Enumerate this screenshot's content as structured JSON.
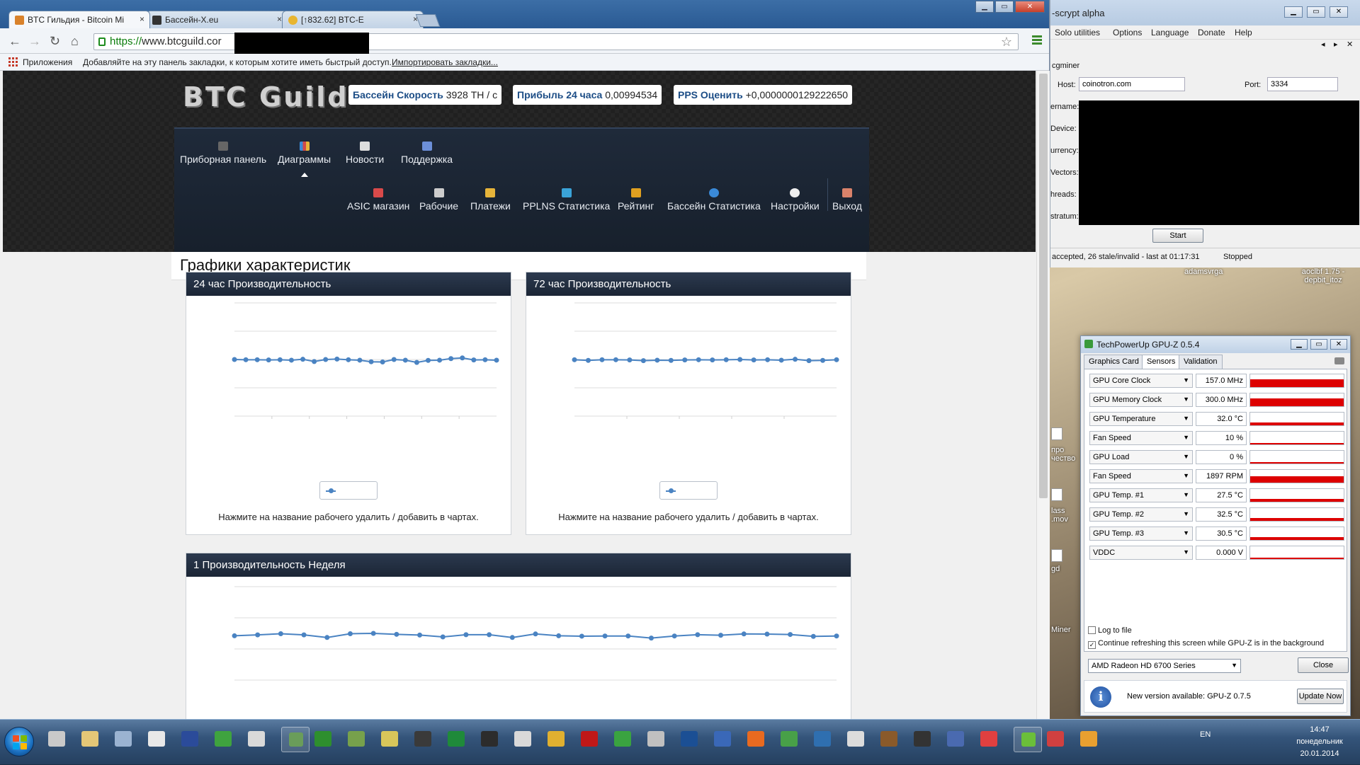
{
  "browser": {
    "tabs": [
      {
        "title": "BTC Гильдия - Bitcoin Mi",
        "favicon_color": "#d9822b",
        "active": true
      },
      {
        "title": "Бассейн-X.eu",
        "favicon_color": "#333333",
        "active": false
      },
      {
        "title": "[↑832.62] BTC-E",
        "favicon_color": "#e8b530",
        "active": false
      }
    ],
    "tab_close": "×",
    "window_buttons": {
      "minimize": "▁",
      "maximize": "▭",
      "close": "✕"
    },
    "nav": {
      "back": "←",
      "forward": "→",
      "reload": "↻",
      "home": "⌂"
    },
    "url_scheme": "https://",
    "url_host": "www.btcguild.cor",
    "star": "☆",
    "bookmarks": {
      "apps_label": "Приложения",
      "hint": "Добавляйте на эту панель закладки, к которым хотите иметь быстрый доступ.",
      "import_link": "Импортировать закладки..."
    }
  },
  "site": {
    "logo": "BTC Guild",
    "stats": [
      {
        "label": "Бассейн Скорость",
        "value": "3928 TH / с"
      },
      {
        "label": "Прибыль 24 часа",
        "value": "0,00994534"
      },
      {
        "label": "PPS Оценить",
        "value": "+0,0000000129222650"
      }
    ],
    "nav_row1": [
      {
        "label": "Приборная панель",
        "icon": "dashboard-icon",
        "color": "#666666"
      },
      {
        "label": "Диаграммы",
        "icon": "chart-icon",
        "color": "#d04a4a"
      },
      {
        "label": "Новости",
        "icon": "news-icon",
        "color": "#dddddd"
      },
      {
        "label": "Поддержка",
        "icon": "support-icon",
        "color": "#6c8fd8"
      }
    ],
    "nav_row2": [
      {
        "label": "ASIC магазин",
        "icon": "shop-icon",
        "color": "#d94a4a"
      },
      {
        "label": "Рабочие",
        "icon": "workers-icon",
        "color": "#cccccc"
      },
      {
        "label": "Платежи",
        "icon": "payments-icon",
        "color": "#e6b43a"
      },
      {
        "label": "PPLNS Статистика",
        "icon": "pplns-icon",
        "color": "#3aa3d8"
      },
      {
        "label": "Рейтинг",
        "icon": "trophy-icon",
        "color": "#e0a020"
      },
      {
        "label": "Бассейн Статистика",
        "icon": "globe-icon",
        "color": "#3a8ad8"
      },
      {
        "label": "Настройки",
        "icon": "gear-icon",
        "color": "#eeeeee"
      },
      {
        "label": "Выход",
        "icon": "logout-icon",
        "color": "#d9826a"
      }
    ],
    "page_title": "Графики характеристик",
    "panels": [
      {
        "title": "24 час Производительность",
        "hint": "Нажмите на название рабочего удалить / добавить в чартах."
      },
      {
        "title": "72 час Производительность",
        "hint": "Нажмите на название рабочего удалить / добавить в чартах."
      },
      {
        "title": "1 Производительность Неделя",
        "hint": ""
      }
    ]
  },
  "chart_data": [
    {
      "type": "line",
      "title": "24 час Производительность",
      "series": [
        {
          "name": "",
          "color": "#4a83c2",
          "values": [
            50.0,
            49.8,
            49.8,
            49.6,
            49.8,
            49.4,
            50.2,
            48.2,
            50.0,
            50.4,
            49.8,
            49.4,
            48.0,
            47.8,
            50.0,
            49.4,
            47.4,
            49.2,
            49.4,
            50.8,
            51.4,
            49.6,
            49.8,
            49.4
          ]
        }
      ],
      "ylim": [
        0,
        100
      ]
    },
    {
      "type": "line",
      "title": "72 час Производительность",
      "series": [
        {
          "name": "",
          "color": "#4a83c2",
          "values": [
            49.8,
            49.2,
            49.8,
            49.8,
            49.6,
            49.0,
            49.4,
            49.2,
            49.6,
            49.8,
            49.6,
            49.8,
            50.0,
            49.6,
            49.8,
            49.4,
            50.2,
            49.0,
            49.2,
            49.8
          ]
        }
      ],
      "ylim": [
        0,
        100
      ]
    },
    {
      "type": "line",
      "title": "1 Производительность Неделя",
      "series": [
        {
          "name": "",
          "color": "#4a83c2",
          "values": [
            47.4,
            48.4,
            49.6,
            48.4,
            45.6,
            49.6,
            50.0,
            49.0,
            48.2,
            46.2,
            48.6,
            48.6,
            45.6,
            49.4,
            47.4,
            47.0,
            47.2,
            47.2,
            45.0,
            47.2,
            48.6,
            48.0,
            49.4,
            49.2,
            48.8,
            46.8,
            47.2
          ]
        }
      ],
      "ylim": [
        0,
        100
      ]
    }
  ],
  "miner": {
    "title": "-scrypt alpha",
    "window_buttons": {
      "minimize": "▁",
      "maximize": "▭",
      "close": "✕"
    },
    "menu": [
      "Solo utilities",
      "Options",
      "Language",
      "Donate",
      "Help"
    ],
    "arrows": {
      "left": "◂",
      "right": "▸",
      "close": "✕"
    },
    "tab_label": "cgminer",
    "host_label": "Host:",
    "host_value": "coinotron.com",
    "port_label": "Port:",
    "port_value": "3334",
    "field_labels": [
      "ername:",
      "Device:",
      "urrency:",
      "Vectors:",
      "hreads:",
      "stratum:"
    ],
    "start": "Start",
    "status_left": "accepted, 26 stale/invalid - last at 01:17:31",
    "status_right": "Stopped"
  },
  "desktop": {
    "labels": [
      "adamsvrga",
      "aoclbf 1.75 - depbit_itoz",
      "про чество",
      "lass .mov",
      "gd",
      "Miner"
    ]
  },
  "gpuz": {
    "title": "TechPowerUp GPU-Z 0.5.4",
    "window_buttons": {
      "minimize": "▁",
      "maximize": "▭",
      "close": "✕"
    },
    "tabs": [
      "Graphics Card",
      "Sensors",
      "Validation"
    ],
    "dropdown_arrow": "▼",
    "sensors": [
      {
        "name": "GPU Core Clock",
        "value": "157.0 MHz",
        "level": 0.8
      },
      {
        "name": "GPU Memory Clock",
        "value": "300.0 MHz",
        "level": 0.8
      },
      {
        "name": "GPU Temperature",
        "value": "32.0 °C",
        "level": 0.3
      },
      {
        "name": "Fan Speed",
        "value": "10 %",
        "level": 0.1
      },
      {
        "name": "GPU Load",
        "value": "0 %",
        "level": 0.0
      },
      {
        "name": "Fan Speed",
        "value": "1897 RPM",
        "level": 0.4
      },
      {
        "name": "GPU Temp. #1",
        "value": "27.5 °C",
        "level": 0.25
      },
      {
        "name": "GPU Temp. #2",
        "value": "32.5 °C",
        "level": 0.3
      },
      {
        "name": "GPU Temp. #3",
        "value": "30.5 °C",
        "level": 0.28
      },
      {
        "name": "VDDC",
        "value": "0.000 V",
        "level": 0.0
      }
    ],
    "log_to_file": "Log to file",
    "continue_refresh": "Continue refreshing this screen while GPU-Z is in the background",
    "check_mark": "✓",
    "card_select": "AMD Radeon HD 6700 Series",
    "close_button": "Close",
    "info_glyph": "i",
    "update_message": "New version available: GPU-Z 0.7.5",
    "update_button": "Update Now"
  },
  "taskbar": {
    "lang": "EN",
    "time": "14:47",
    "day": "понедельник",
    "date": "20.01.2014",
    "icon_colors": [
      "#c9c9c9",
      "#e4c777",
      "#9bb3d1",
      "#e8e8e8",
      "#2b4b9a",
      "#3fa33f",
      "#d9d9d9",
      "#6a9d5a",
      "#2e8f2e",
      "#77a14c",
      "#d8c65a",
      "#3a3a3a",
      "#1f8a3a",
      "#2c2c2c",
      "#d9d9d9",
      "#e0b030",
      "#c01818",
      "#3aa340",
      "#c0c0c0",
      "#1b4f94",
      "#3a68b8",
      "#e86a20",
      "#48a048",
      "#2f6fb0",
      "#dcdcdc",
      "#8a5a2a",
      "#333333",
      "#4a6ab0",
      "#e04040",
      "#6bbf3a",
      "#d04040",
      "#e8a030"
    ]
  }
}
